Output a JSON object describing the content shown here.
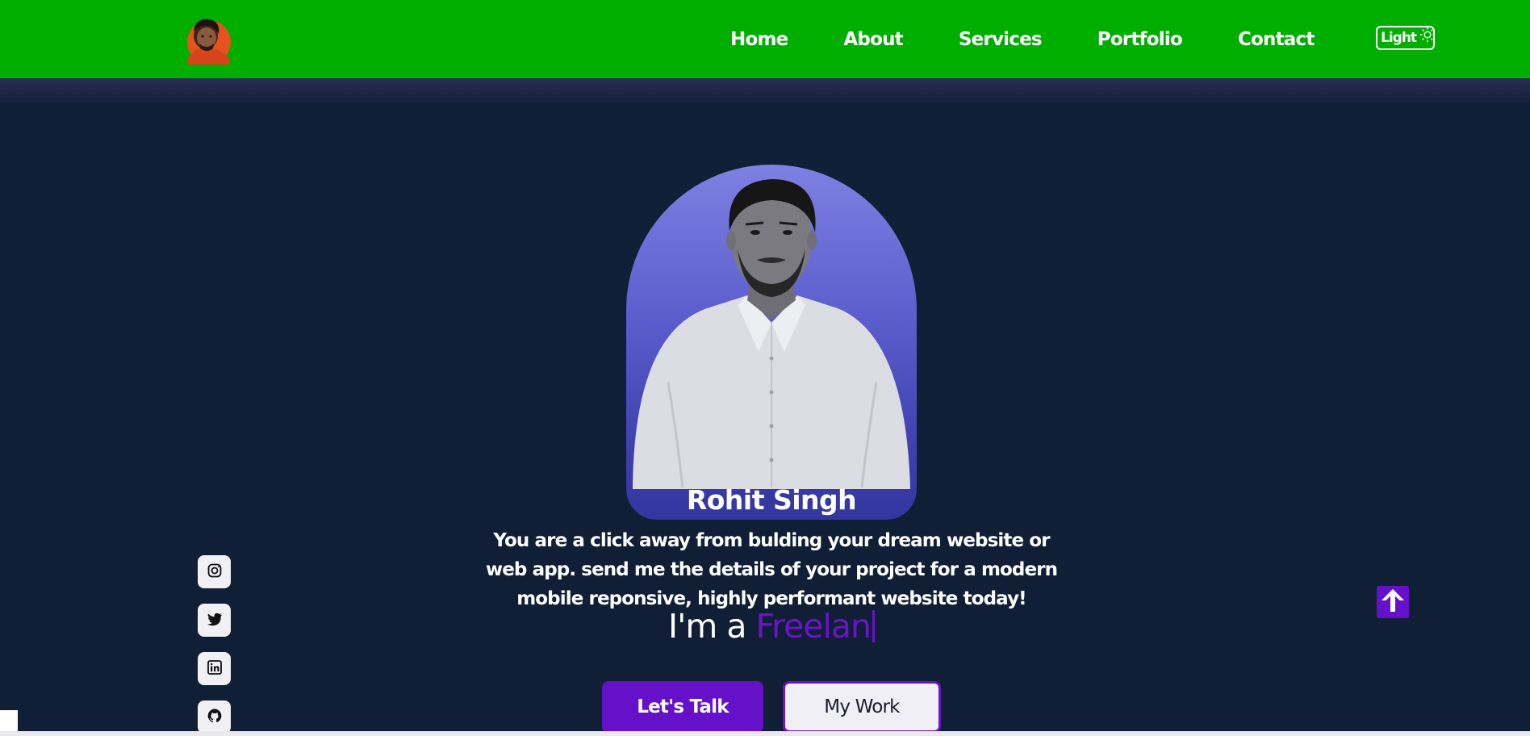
{
  "nav": {
    "logo_icon": "profile-avatar",
    "links": [
      "Home",
      "About",
      "Services",
      "Portfolio",
      "Contact"
    ],
    "theme_toggle_label": "Light",
    "theme_icon": "sun-icon",
    "background_color": "#00ae00"
  },
  "hero": {
    "name": "Rohit Singh",
    "description": "You are a click away from bulding your dream website or web app. send me the details of your project for a modern mobile reponsive, highly performant website today!",
    "role_prefix": "I'm a ",
    "role_typed": "Freelan",
    "primary_button": "Let's Talk",
    "secondary_button": "My Work",
    "accent_color": "#6510c9"
  },
  "social": [
    {
      "icon": "instagram-icon"
    },
    {
      "icon": "twitter-icon"
    },
    {
      "icon": "linkedin-icon"
    },
    {
      "icon": "github-icon"
    }
  ],
  "scroll_top_icon": "arrow-up-icon",
  "page_background": "#101f35"
}
